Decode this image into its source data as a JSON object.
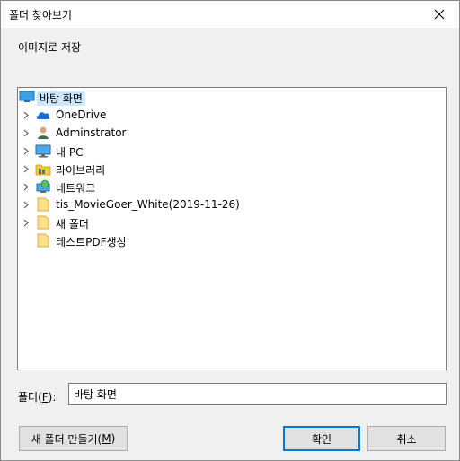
{
  "window": {
    "title": "폴더 찾아보기"
  },
  "prompt": "이미지로 저장",
  "tree": {
    "items": [
      {
        "label": "바탕 화면",
        "icon": "desktop-icon",
        "expandable": false,
        "selected": true
      },
      {
        "label": "OneDrive",
        "icon": "cloud-icon",
        "expandable": true
      },
      {
        "label": "Adminstrator",
        "icon": "user-icon",
        "expandable": true
      },
      {
        "label": "내 PC",
        "icon": "computer-icon",
        "expandable": true
      },
      {
        "label": "라이브러리",
        "icon": "library-icon",
        "expandable": true
      },
      {
        "label": "네트워크",
        "icon": "network-icon",
        "expandable": true
      },
      {
        "label": "tis_MovieGoer_White(2019-11-26)",
        "icon": "folder-icon",
        "expandable": true
      },
      {
        "label": "새 폴더",
        "icon": "folder-icon",
        "expandable": true
      },
      {
        "label": "테스트PDF생성",
        "icon": "folder-icon",
        "expandable": false
      }
    ]
  },
  "folder": {
    "label": "폴더(",
    "mnemonic": "F",
    "label_end": "):",
    "value": "바탕 화면"
  },
  "buttons": {
    "new_folder": {
      "label": "새 폴더 만들기(",
      "mnemonic": "M",
      "label_end": ")"
    },
    "ok": "확인",
    "cancel": "취소"
  },
  "colors": {
    "selection": "#cce8ff",
    "accent": "#0078d7",
    "dialog_bg": "#f0f0f0"
  }
}
